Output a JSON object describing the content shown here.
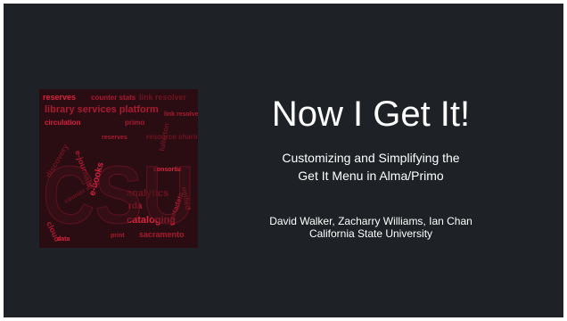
{
  "slide": {
    "title": "Now I Get It!",
    "subtitle": {
      "line1": "Customizing and Simplifying the",
      "line2": "Get It Menu in Alma/Primo"
    },
    "authors": {
      "names": "David Walker, Zacharry Williams, Ian Chan",
      "affiliation": "California State University"
    }
  },
  "logo": {
    "letters": "CSU",
    "words": [
      "reserves",
      "counter stats",
      "link resolver",
      "library services platform",
      "circulation",
      "primo",
      "discovery",
      "e-journals",
      "e-books",
      "cloud",
      "analytics",
      "rda",
      "cataloging",
      "sacramento",
      "fullerton",
      "unified",
      "consortia",
      "metadata",
      "resource sharing",
      "print",
      "data"
    ],
    "colors": {
      "background": "#2a0d12",
      "letter_fill": "#3a1218",
      "word_bright": "#d8233f",
      "word_mid": "#a81b31",
      "word_dim": "#6d1422"
    }
  }
}
